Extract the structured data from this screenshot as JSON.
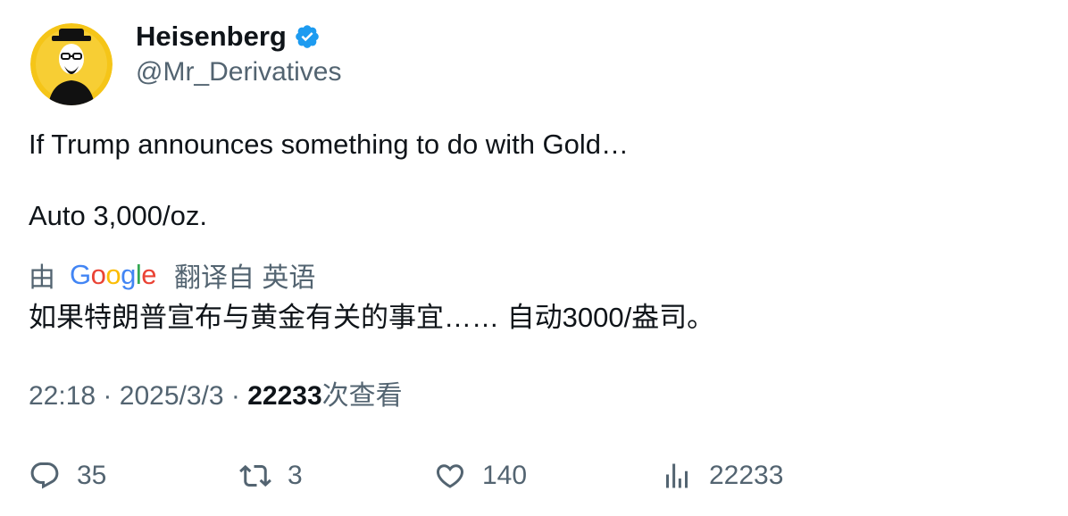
{
  "author": {
    "name": "Heisenberg",
    "handle": "@Mr_Derivatives",
    "verified": true,
    "avatar_icon": "heisenberg-avatar-icon"
  },
  "tweet": {
    "line1": "If Trump announces something to do with Gold…",
    "line2": "Auto 3,000/oz."
  },
  "translation": {
    "prefix": "由",
    "provider": "Google",
    "suffix": "翻译自 英语",
    "text": "如果特朗普宣布与黄金有关的事宜…… 自动3000/盎司。"
  },
  "meta": {
    "time": "22:18",
    "sep1": "·",
    "date": "2025/3/3",
    "sep2": "·",
    "views": "22233",
    "views_label": "次查看"
  },
  "actions": {
    "replies": "35",
    "retweets": "3",
    "likes": "140",
    "views": "22233"
  },
  "colors": {
    "text": "#0f1419",
    "secondary": "#536471",
    "verified": "#1d9bf0",
    "avatar_bg": "#f5c518"
  }
}
